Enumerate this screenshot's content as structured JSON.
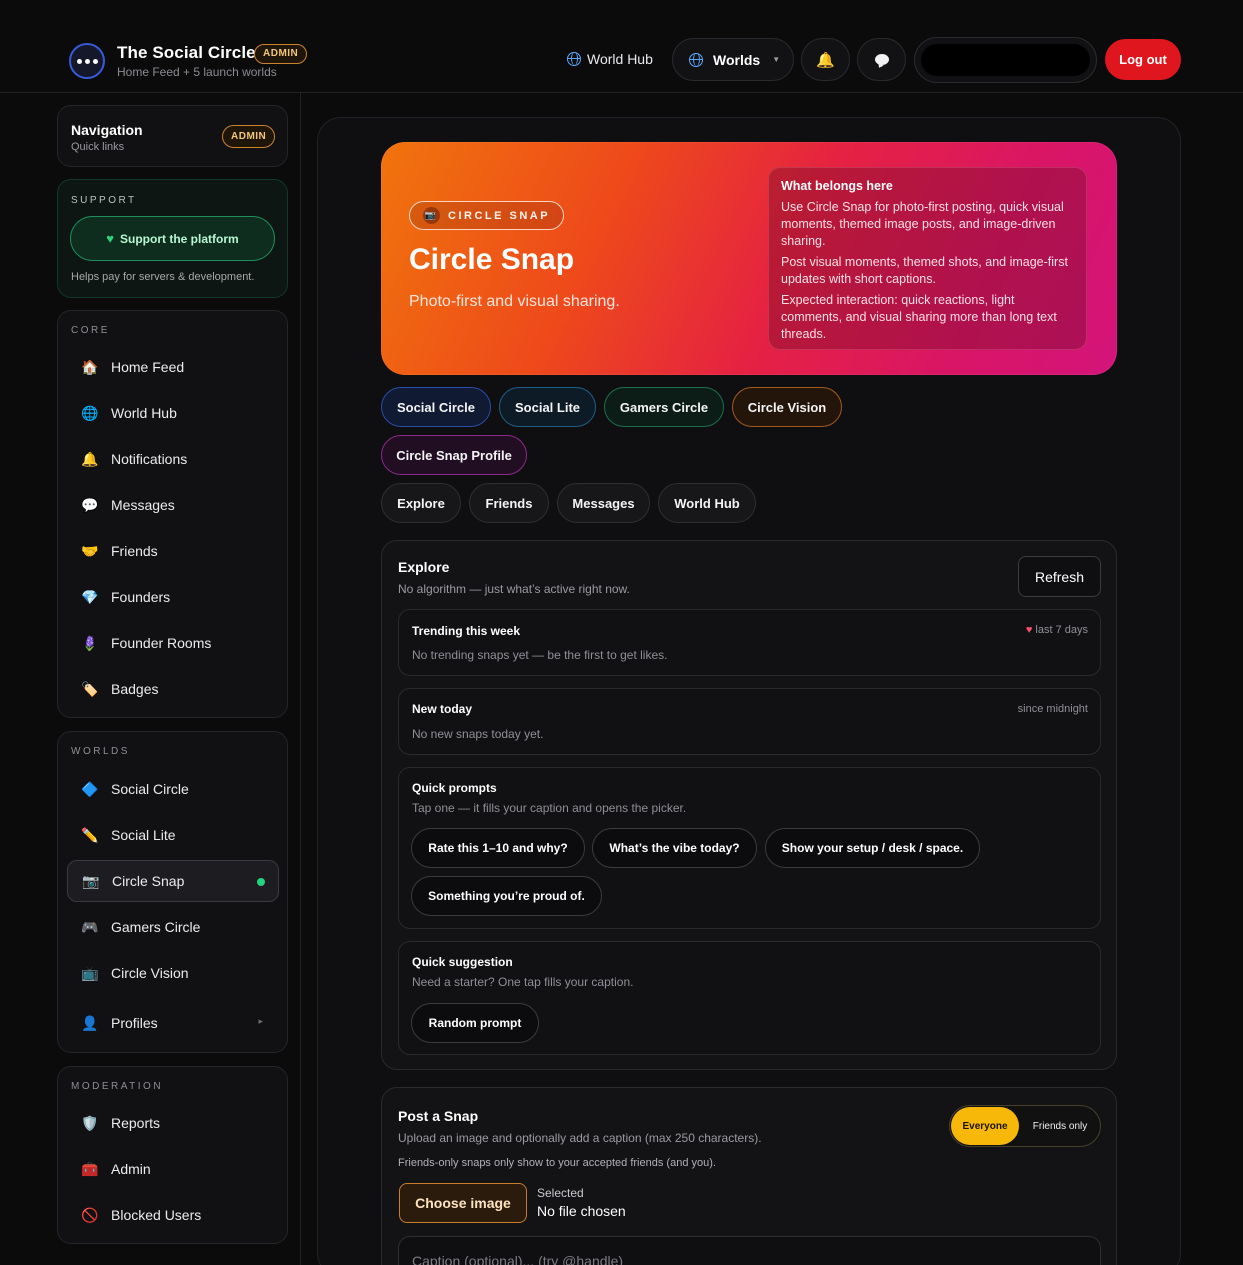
{
  "header": {
    "brand_title": "The Social Circle",
    "brand_badge": "ADMIN",
    "brand_subtitle": "Home Feed + 5 launch worlds",
    "world_hub_link": "World Hub",
    "worlds_button": "Worlds",
    "logout": "Log out",
    "icons": [
      "dots-icon",
      "globe-icon",
      "bell-icon",
      "chat-icon"
    ]
  },
  "sidebar": {
    "nav_title": "Navigation",
    "nav_sub": "Quick links",
    "nav_badge": "ADMIN",
    "support": {
      "label": "SUPPORT",
      "button": "Support the platform",
      "note": "Helps pay for servers & development."
    },
    "core": {
      "label": "CORE",
      "items": [
        {
          "label": "Home Feed",
          "icon": "🏠"
        },
        {
          "label": "World Hub",
          "icon": "🌐"
        },
        {
          "label": "Notifications",
          "icon": "🔔"
        },
        {
          "label": "Messages",
          "icon": "💬"
        },
        {
          "label": "Friends",
          "icon": "🤝"
        },
        {
          "label": "Founders",
          "icon": "💎"
        },
        {
          "label": "Founder Rooms",
          "icon": "🪻"
        },
        {
          "label": "Badges",
          "icon": "🏷️"
        }
      ]
    },
    "worlds": {
      "label": "WORLDS",
      "items": [
        {
          "label": "Social Circle",
          "icon": "🔷"
        },
        {
          "label": "Social Lite",
          "icon": "✏️"
        },
        {
          "label": "Circle Snap",
          "icon": "📷"
        },
        {
          "label": "Gamers Circle",
          "icon": "🎮"
        },
        {
          "label": "Circle Vision",
          "icon": "📺"
        },
        {
          "label": "Profiles",
          "icon": "👤"
        }
      ]
    },
    "moderation": {
      "label": "MODERATION",
      "items": [
        {
          "label": "Reports",
          "icon": "🛡️"
        },
        {
          "label": "Admin",
          "icon": "🧰"
        },
        {
          "label": "Blocked Users",
          "icon": "🚫"
        }
      ]
    }
  },
  "hero": {
    "tag": "CIRCLE SNAP",
    "title": "Circle Snap",
    "subtitle": "Photo-first and visual sharing.",
    "box_title": "What belongs here",
    "box_lines": [
      "Use Circle Snap for photo-first posting, quick visual moments, themed image posts, and image-driven sharing.",
      "Post visual moments, themed shots, and image-first updates with short captions.",
      "Expected interaction: quick reactions, light comments, and visual sharing more than long text threads."
    ]
  },
  "world_pills": [
    "Social Circle",
    "Social Lite",
    "Gamers Circle",
    "Circle Vision",
    "Circle Snap Profile"
  ],
  "tab_pills": [
    "Explore",
    "Friends",
    "Messages",
    "World Hub"
  ],
  "explore": {
    "title": "Explore",
    "subtitle": "No algorithm — just what’s active right now.",
    "refresh": "Refresh",
    "trending": {
      "title": "Trending this week",
      "meta": "last 7 days",
      "empty": "No trending snaps yet — be the first to get likes."
    },
    "new_today": {
      "title": "New today",
      "meta": "since midnight",
      "empty": "No new snaps today yet."
    },
    "quick_prompts": {
      "title": "Quick prompts",
      "subtitle": "Tap one — it fills your caption and opens the picker.",
      "prompts": [
        "Rate this 1–10 and why?",
        "What’s the vibe today?",
        "Show your setup / desk / space.",
        "Something you’re proud of."
      ]
    },
    "quick_suggestion": {
      "title": "Quick suggestion",
      "subtitle": "Need a starter? One tap fills your caption.",
      "button": "Random prompt"
    }
  },
  "post": {
    "title": "Post a Snap",
    "subtitle": "Upload an image and optionally add a caption (max 250 characters).",
    "note": "Friends-only snaps only show to your accepted friends (and you).",
    "visibility": {
      "selected": "Everyone",
      "other": "Friends only"
    },
    "choose": "Choose image",
    "selected_label": "Selected",
    "selected_value": "No file chosen",
    "caption_placeholder": "Caption (optional)... (try @handle)"
  }
}
